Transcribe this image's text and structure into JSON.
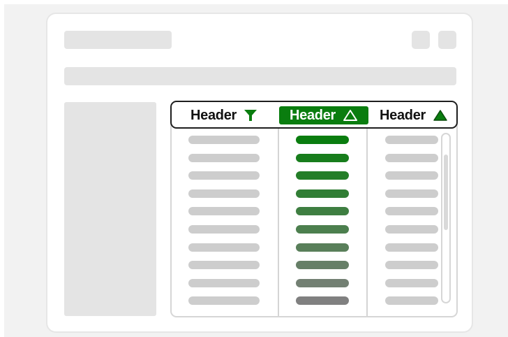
{
  "table": {
    "columns": [
      {
        "label": "Header",
        "icon": "filter-icon",
        "active": false
      },
      {
        "label": "Header",
        "icon": "sort-ascending-icon",
        "active": true
      },
      {
        "label": "Header",
        "icon": "sort-ascending-icon",
        "active": false
      }
    ],
    "row_count": 10
  },
  "colors": {
    "accent": "#0a7d0f",
    "placeholder": "#e4e4e4",
    "row_placeholder": "#cdcdcd",
    "header_border": "#1e1e1e",
    "sorted_column_gradient": [
      "#0a7d0f",
      "#808080"
    ]
  },
  "scrollbar": {
    "position": 0.12,
    "visible_fraction": 0.45
  }
}
